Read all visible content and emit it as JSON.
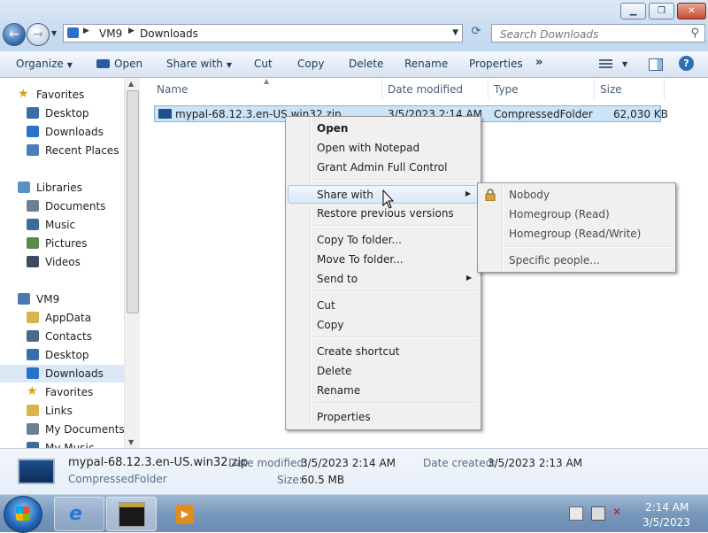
{
  "window": {
    "controls": {
      "minimize": "▁",
      "maximize": "❐",
      "close": "✕"
    }
  },
  "address": {
    "crumbs": [
      "VM9",
      "Downloads"
    ],
    "search_placeholder": "Search Downloads"
  },
  "toolbar": {
    "organize": "Organize",
    "open": "Open",
    "share_with": "Share with",
    "cut": "Cut",
    "copy": "Copy",
    "delete": "Delete",
    "rename": "Rename",
    "properties": "Properties",
    "more": "»"
  },
  "navpane": {
    "items": [
      {
        "label": "Favorites",
        "icon": "star-icon",
        "indent": 0
      },
      {
        "label": "Desktop",
        "icon": "desktop-icon",
        "indent": 1
      },
      {
        "label": "Downloads",
        "icon": "downloads-icon",
        "indent": 1
      },
      {
        "label": "Recent Places",
        "icon": "recent-places-icon",
        "indent": 1
      },
      {
        "label": "Libraries",
        "icon": "libraries-icon",
        "indent": 0
      },
      {
        "label": "Documents",
        "icon": "documents-icon",
        "indent": 1
      },
      {
        "label": "Music",
        "icon": "music-icon",
        "indent": 1
      },
      {
        "label": "Pictures",
        "icon": "pictures-icon",
        "indent": 1
      },
      {
        "label": "Videos",
        "icon": "videos-icon",
        "indent": 1
      },
      {
        "label": "VM9",
        "icon": "user-folder-icon",
        "indent": 0
      },
      {
        "label": "AppData",
        "icon": "folder-icon",
        "indent": 1
      },
      {
        "label": "Contacts",
        "icon": "contacts-icon",
        "indent": 1
      },
      {
        "label": "Desktop",
        "icon": "desktop-icon",
        "indent": 1
      },
      {
        "label": "Downloads",
        "icon": "downloads-icon",
        "indent": 1,
        "selected": true
      },
      {
        "label": "Favorites",
        "icon": "star-icon",
        "indent": 1
      },
      {
        "label": "Links",
        "icon": "links-icon",
        "indent": 1
      },
      {
        "label": "My Documents",
        "icon": "documents-icon",
        "indent": 1
      },
      {
        "label": "My Music",
        "icon": "music-icon",
        "indent": 1
      }
    ]
  },
  "filelist": {
    "columns": {
      "name": "Name",
      "date": "Date modified",
      "type": "Type",
      "size": "Size"
    },
    "rows": [
      {
        "name": "mypal-68.12.3.en-US.win32.zip",
        "date": "3/5/2023 2:14 AM",
        "type": "CompressedFolder",
        "size": "62,030 KB"
      }
    ]
  },
  "context_menu": {
    "items": [
      {
        "label": "Open",
        "bold": true
      },
      {
        "label": "Open with Notepad"
      },
      {
        "label": "Grant Admin Full Control"
      },
      {
        "label": "Share with",
        "submenu": true,
        "highlighted": true
      },
      {
        "label": "Restore previous versions"
      },
      {
        "label": "Copy To folder..."
      },
      {
        "label": "Move To folder..."
      },
      {
        "label": "Send to",
        "submenu": true
      },
      {
        "label": "Cut"
      },
      {
        "label": "Copy"
      },
      {
        "label": "Create shortcut"
      },
      {
        "label": "Delete"
      },
      {
        "label": "Rename"
      },
      {
        "label": "Properties"
      }
    ]
  },
  "share_submenu": {
    "items": [
      "Nobody",
      "Homegroup (Read)",
      "Homegroup (Read/Write)",
      "Specific people..."
    ]
  },
  "details": {
    "name": "mypal-68.12.3.en-US.win32.zip",
    "type": "CompressedFolder",
    "date_modified_label": "Date modified:",
    "date_modified": "3/5/2023 2:14 AM",
    "date_created_label": "Date created:",
    "date_created": "3/5/2023 2:13 AM",
    "size_label": "Size:",
    "size": "60.5 MB"
  },
  "taskbar": {
    "clock_time": "2:14 AM",
    "clock_date": "3/5/2023",
    "apps": [
      "internet-explorer-icon",
      "command-prompt-icon",
      "media-player-icon"
    ]
  },
  "colors": {
    "selection": "#cce4f7",
    "menu_bg": "#f0f0f0",
    "toolbar_text": "#1e395b",
    "taskbar": "#7898bc"
  }
}
